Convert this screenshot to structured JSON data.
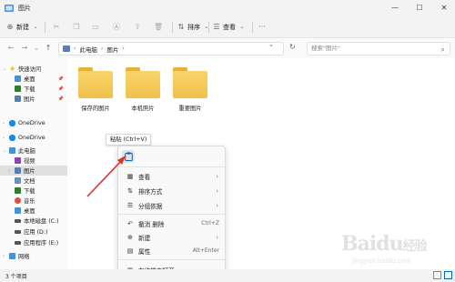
{
  "window": {
    "title": "图片",
    "minimize": "—",
    "maximize": "☐",
    "close": "✕"
  },
  "toolbar": {
    "new_label": "新建",
    "sort_label": "排序",
    "view_label": "查看",
    "more": "···"
  },
  "address": {
    "crumbs": [
      "此电脑",
      "图片"
    ],
    "search_placeholder": "搜索\"图片\""
  },
  "sidebar": {
    "items": [
      {
        "label": "快速访问",
        "icon": "star-icon",
        "color": "#f0b429"
      },
      {
        "label": "桌面",
        "icon": "desktop-icon",
        "color": "#4a90d9"
      },
      {
        "label": "下载",
        "icon": "download-icon",
        "color": "#2e7d32"
      },
      {
        "label": "图片",
        "icon": "pictures-icon",
        "color": "#5b7fa8"
      },
      {
        "label": "OneDrive",
        "icon": "cloud-icon",
        "color": "#1e88e5"
      },
      {
        "label": "OneDrive",
        "icon": "cloud-icon",
        "color": "#1e88e5"
      },
      {
        "label": "此电脑",
        "icon": "computer-icon",
        "color": "#4a90d9"
      },
      {
        "label": "视频",
        "icon": "video-icon",
        "color": "#8e44ad"
      },
      {
        "label": "图片",
        "icon": "pictures-icon",
        "color": "#5b7fa8"
      },
      {
        "label": "文档",
        "icon": "document-icon",
        "color": "#6c8ebf"
      },
      {
        "label": "下载",
        "icon": "download-icon",
        "color": "#2e7d32"
      },
      {
        "label": "音乐",
        "icon": "music-icon",
        "color": "#e74c3c"
      },
      {
        "label": "桌面",
        "icon": "desktop-icon",
        "color": "#4a90d9"
      },
      {
        "label": "本地磁盘 (C:)",
        "icon": "drive-icon",
        "color": "#555555"
      },
      {
        "label": "应用 (D:)",
        "icon": "drive-icon",
        "color": "#555555"
      },
      {
        "label": "应用程序 (E:)",
        "icon": "drive-icon",
        "color": "#555555"
      },
      {
        "label": "网络",
        "icon": "network-icon",
        "color": "#4a90d9"
      }
    ]
  },
  "folders": [
    {
      "label": "保存的图片"
    },
    {
      "label": "本机照片"
    },
    {
      "label": "重要图片"
    }
  ],
  "tooltip": "粘贴 (Ctrl+V)",
  "context_menu": {
    "items": [
      {
        "label": "查看",
        "icon": "grid-icon",
        "has_submenu": true,
        "shortcut": ""
      },
      {
        "label": "排序方式",
        "icon": "sort-icon",
        "has_submenu": true,
        "shortcut": ""
      },
      {
        "label": "分组依据",
        "icon": "group-icon",
        "has_submenu": true,
        "shortcut": ""
      },
      {
        "label": "撤消 删除",
        "icon": "undo-icon",
        "has_submenu": false,
        "shortcut": "Ctrl+Z"
      },
      {
        "label": "新建",
        "icon": "plus-circle-icon",
        "has_submenu": true,
        "shortcut": ""
      },
      {
        "label": "属性",
        "icon": "properties-icon",
        "has_submenu": false,
        "shortcut": "Alt+Enter"
      },
      {
        "label": "在终端中打开",
        "icon": "terminal-icon",
        "has_submenu": false,
        "shortcut": ""
      }
    ]
  },
  "status": {
    "text": "3 个项目"
  },
  "colors": {
    "folder": "#f0c04a",
    "accent": "#0067c0",
    "arrow": "#d9342b"
  }
}
